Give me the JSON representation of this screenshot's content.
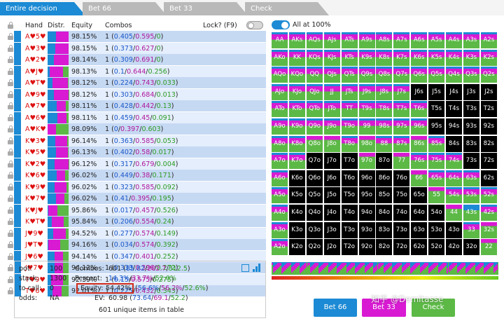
{
  "tabs": [
    {
      "label": "Entire decision",
      "active": true
    },
    {
      "label": "Bet 66"
    },
    {
      "label": "Bet 33"
    },
    {
      "label": "Check"
    }
  ],
  "table": {
    "headers": {
      "hand": "Hand",
      "distr": "Distr.",
      "equity": "Equity",
      "combos": "Combos",
      "lock": "Lock? (F9)"
    },
    "rows": [
      {
        "hand": "A♥5♥",
        "eq": "98.15%",
        "n": "1",
        "b": "0.405",
        "m": "0.595",
        "g": "0"
      },
      {
        "hand": "A♥3♥",
        "eq": "98.15%",
        "n": "1",
        "b": "0.373",
        "m": "0.627",
        "g": "0"
      },
      {
        "hand": "A♥2♥",
        "eq": "98.14%",
        "n": "1",
        "b": "0.309",
        "m": "0.691",
        "g": "0"
      },
      {
        "hand": "A♥J♥",
        "eq": "98.13%",
        "n": "1",
        "b": "0.1",
        "m": "0.644",
        "g": "0.256"
      },
      {
        "hand": "A♥T♥",
        "eq": "98.12%",
        "n": "1",
        "b": "0.224",
        "m": "0.743",
        "g": "0.033"
      },
      {
        "hand": "A♥9♥",
        "eq": "98.12%",
        "n": "1",
        "b": "0.303",
        "m": "0.684",
        "g": "0.013"
      },
      {
        "hand": "A♥7♥",
        "eq": "98.11%",
        "n": "1",
        "b": "0.428",
        "m": "0.442",
        "g": "0.13"
      },
      {
        "hand": "A♥6♥",
        "eq": "98.11%",
        "n": "1",
        "b": "0.459",
        "m": "0.45",
        "g": "0.091"
      },
      {
        "hand": "A♥K♥",
        "eq": "98.09%",
        "n": "1",
        "b": "0",
        "m": "0.397",
        "g": "0.603"
      },
      {
        "hand": "K♥3♥",
        "eq": "96.14%",
        "n": "1",
        "b": "0.363",
        "m": "0.585",
        "g": "0.053"
      },
      {
        "hand": "K♥5♥",
        "eq": "96.13%",
        "n": "1",
        "b": "0.402",
        "m": "0.58",
        "g": "0.017"
      },
      {
        "hand": "K♥2♥",
        "eq": "96.12%",
        "n": "1",
        "b": "0.317",
        "m": "0.679",
        "g": "0.004"
      },
      {
        "hand": "K♥6♥",
        "eq": "96.02%",
        "n": "1",
        "b": "0.449",
        "m": "0.38",
        "g": "0.171"
      },
      {
        "hand": "K♥9♥",
        "eq": "96.02%",
        "n": "1",
        "b": "0.323",
        "m": "0.585",
        "g": "0.092"
      },
      {
        "hand": "K♥7♥",
        "eq": "96.02%",
        "n": "1",
        "b": "0.41",
        "m": "0.395",
        "g": "0.195"
      },
      {
        "hand": "K♥J♥",
        "eq": "95.86%",
        "n": "1",
        "b": "0.017",
        "m": "0.457",
        "g": "0.526"
      },
      {
        "hand": "K♥T♥",
        "eq": "95.84%",
        "n": "1",
        "b": "0.206",
        "m": "0.554",
        "g": "0.24"
      },
      {
        "hand": "J♥9♥",
        "eq": "94.52%",
        "n": "1",
        "b": "0.277",
        "m": "0.574",
        "g": "0.149"
      },
      {
        "hand": "J♥T♥",
        "eq": "94.16%",
        "n": "1",
        "b": "0.034",
        "m": "0.574",
        "g": "0.392"
      },
      {
        "hand": "J♥6♥",
        "eq": "94.14%",
        "n": "1",
        "b": "0.347",
        "m": "0.401",
        "g": "0.252"
      },
      {
        "hand": "J♥7♥",
        "eq": "94.12%",
        "n": "1",
        "b": "0.333",
        "m": "0.396",
        "g": "0.272"
      },
      {
        "hand": "T♥9♥",
        "eq": "92.39%",
        "n": "1",
        "b": "0.15",
        "m": "0.575",
        "g": "0.275"
      },
      {
        "hand": "T♥6♥",
        "eq": "92.01%",
        "n": "1",
        "b": "0.225",
        "m": "0.432",
        "g": "0.343"
      }
    ]
  },
  "stats": {
    "pot_label": "pot:",
    "pot": "100",
    "stack_label": "stack:",
    "stack": "1300",
    "tocall_label": "to call:",
    "tocall": "0",
    "odds_label": "odds:",
    "odds": "NA",
    "combos_label": "Combos:",
    "combos_total": "601",
    "combos_b": "85.82",
    "combos_m": "202.7",
    "combos_g": "312.5",
    "percent_label": "Percent:",
    "percent_b": "14.3%",
    "percent_m": "33.7%",
    "percent_g": "52.0%",
    "equity_label": "Equity:",
    "equity_total": "54.42%",
    "equity_b": "56.6%",
    "equity_m": "56.2%",
    "equity_g": "52.6%",
    "ev_label": "EV:",
    "ev_total": "60.98",
    "ev_b": "73.64",
    "ev_m": "69.1",
    "ev_g": "52.2",
    "unique": "601 unique items in table"
  },
  "grid_header": {
    "all_label": "All at 100%"
  },
  "ranks": [
    "A",
    "K",
    "Q",
    "J",
    "T",
    "9",
    "8",
    "7",
    "6",
    "5",
    "4",
    "3",
    "2"
  ],
  "grid_types": [
    "mmmmmmmmmmmmm",
    "mmmmmmmmmmmmm",
    "mmmmmmmmmmmmm",
    "mmmmmmmmxxxxx",
    "mmmmmmmmmxxxx",
    "mmmmmmmmmxxxx",
    "mmggmgmmgmxxx",
    "mmxxxgxgmmmxx",
    "mxxxxxxxgmmmx",
    "mxxxxxxxxgmmm",
    "mxxxxxxxxxgcm",
    "mxxxxxxxxxxmg",
    "mxxxxxxxxxxxg"
  ],
  "buttons": {
    "bet66": "Bet 66",
    "bet33": "Bet 33",
    "check": "Check"
  },
  "watermark": "知乎 @Demitasse",
  "colors": {
    "bet66": "#1c8ad4",
    "bet33": "#d81ad2",
    "check": "#5cb946",
    "fold": "#000000",
    "tab_active": "#1c8ad4",
    "tab_inactive": "#b9b9b9",
    "row_even": "#c6d9f3",
    "row_odd": "#e4eefc"
  }
}
